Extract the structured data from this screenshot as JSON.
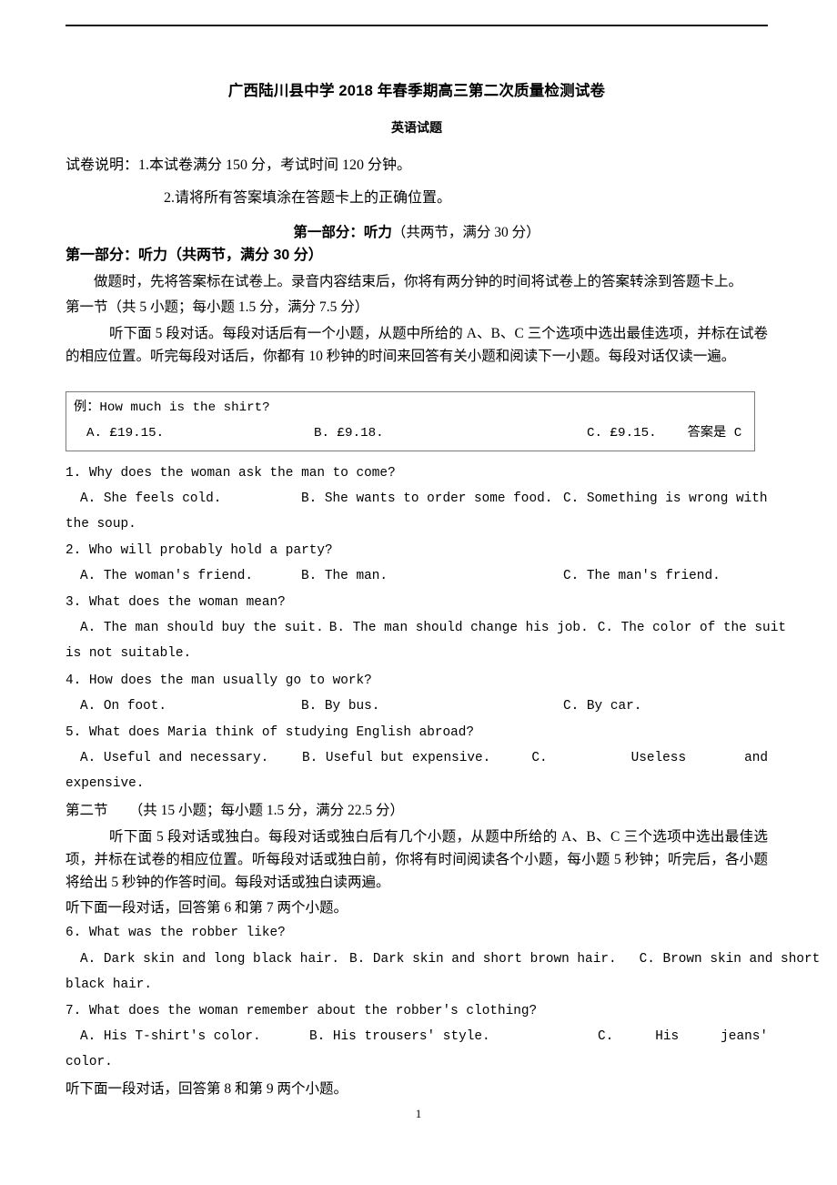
{
  "document": {
    "title": "广西陆川县中学 2018 年春季期高三第二次质量检测试卷",
    "subtitle": "英语试题",
    "page_number": "1"
  },
  "instructions": {
    "line1": "试卷说明：1.本试卷满分 150 分，考试时间 120 分钟。",
    "line2": "2.请将所有答案填涂在答题卡上的正确位置。"
  },
  "part_one": {
    "centered_heading_bold": "第一部分：听力",
    "centered_heading_rest": "（共两节，满分 30 分）",
    "bold_heading": "第一部分：听力（共两节，满分 30 分）",
    "procedure": "做题时，先将答案标在试卷上。录音内容结束后，你将有两分钟的时间将试卷上的答案转涂到答题卡上。",
    "section_one_title": "第一节（共 5 小题；每小题 1.5 分，满分 7.5 分）",
    "section_one_directions": "听下面 5 段对话。每段对话后有一个小题，从题中所给的 A、B、C 三个选项中选出最佳选项，并标在试卷的相应位置。听完每段对话后，你都有 10 秒钟的时间来回答有关小题和阅读下一小题。每段对话仅读一遍。"
  },
  "example_box": {
    "question": "例：How much is the shirt?",
    "option_a": "A. £19.15.",
    "option_b": "B. £9.18.",
    "option_c": "C. £9.15.",
    "answer": "答案是 C"
  },
  "questions": [
    {
      "number": "1.",
      "stem": "1. Why does the woman ask the man to come?",
      "option_a": "A. She feels cold.",
      "option_b": "B. She wants to order some food.",
      "option_c": "C. Something is wrong with",
      "continuation": "the soup."
    },
    {
      "number": "2.",
      "stem": "2. Who will probably hold a party?",
      "option_a": "A. The woman's friend.",
      "option_b": "B. The man.",
      "option_c": "C. The man's friend.",
      "continuation": ""
    },
    {
      "number": "3.",
      "stem": "3. What does the woman mean?",
      "option_a": "A. The man should buy the suit.",
      "option_b": "B. The man should change his job.",
      "option_c": "C. The color of the suit",
      "continuation": "is not suitable."
    },
    {
      "number": "4.",
      "stem": "4. How does the man usually go to work?",
      "option_a": "A. On foot.",
      "option_b": "B. By bus.",
      "option_c": "C. By car.",
      "continuation": ""
    },
    {
      "number": "5.",
      "stem": "5. What does Maria think of studying English abroad?",
      "option_a": "A. Useful and necessary.",
      "option_b": "B. Useful but expensive.",
      "option_c_label": "C.",
      "option_c_word1": "Useless",
      "option_c_word2": "and",
      "continuation": "expensive."
    }
  ],
  "section_two": {
    "title": "第二节　　（共 15 小题；每小题 1.5 分，满分 22.5 分）",
    "directions": "听下面 5 段对话或独白。每段对话或独白后有几个小题，从题中所给的 A、B、C 三个选项中选出最佳选项，并标在试卷的相应位置。听每段对话或独白前，你将有时间阅读各个小题，每小题 5 秒钟；听完后，各小题将给出 5 秒钟的作答时间。每段对话或独白读两遍。",
    "dialog_cue_1": "听下面一段对话，回答第 6 和第 7 两个小题。",
    "dialog_cue_2": "听下面一段对话，回答第 8 和第 9 两个小题。"
  },
  "questions_two": [
    {
      "number": "6.",
      "stem": "6. What was the robber like?",
      "option_a": "A. Dark skin and long black hair.",
      "option_b": "B. Dark skin and short brown hair.",
      "option_c": "C. Brown skin and short",
      "continuation": "black hair."
    },
    {
      "number": "7.",
      "stem": "7. What does the woman remember about the robber's clothing?",
      "option_a": "A. His T-shirt's color.",
      "option_b": "B. His trousers' style.",
      "option_c_label": "C.",
      "option_c_word1": "His",
      "option_c_word2": "jeans'",
      "continuation": "color."
    }
  ]
}
